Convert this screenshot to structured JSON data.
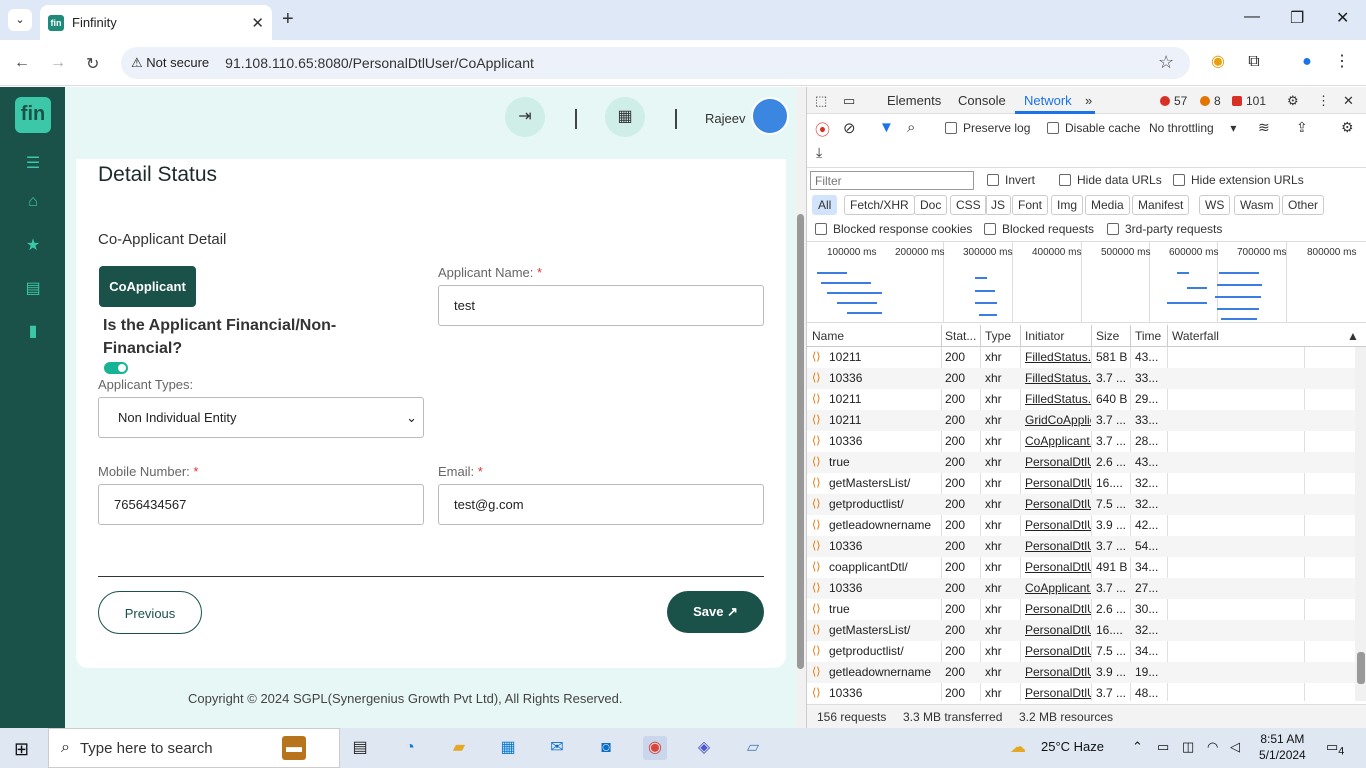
{
  "browser": {
    "tab_title": "Finfinity",
    "not_secure": "Not secure",
    "url": "91.108.110.65:8080/PersonalDtlUser/CoApplicant"
  },
  "app": {
    "logo_text": "fin",
    "user_name": "Rajeev",
    "page_title": "Detail Status",
    "section_title": "Co-Applicant Detail",
    "coapplicant_button": "CoApplicant",
    "question": "Is the Applicant Financial/Non-Financial?",
    "applicant_types_label": "Applicant Types:",
    "applicant_types_value": "Non Individual Entity",
    "applicant_name_label": "Applicant Name:",
    "applicant_name_value": "test",
    "mobile_label": "Mobile Number:",
    "mobile_value": "7656434567",
    "email_label": "Email:",
    "email_value": "test@g.com",
    "required_mark": "*",
    "previous_button": "Previous",
    "save_button": "Save ↗",
    "footer": "Copyright © 2024 SGPL(Synergenius Growth Pvt Ltd), All Rights Reserved."
  },
  "devtools": {
    "tabs": [
      "Elements",
      "Console",
      "Network"
    ],
    "errors": "57",
    "warnings": "8",
    "issues": "101",
    "preserve_log": "Preserve log",
    "disable_cache": "Disable cache",
    "throttling": "No throttling",
    "filter_placeholder": "Filter",
    "invert": "Invert",
    "hide_data_urls": "Hide data URLs",
    "hide_extension_urls": "Hide extension URLs",
    "type_filters": [
      "All",
      "Fetch/XHR",
      "Doc",
      "CSS",
      "JS",
      "Font",
      "Img",
      "Media",
      "Manifest",
      "WS",
      "Wasm",
      "Other"
    ],
    "blocked_cookies": "Blocked response cookies",
    "blocked_requests": "Blocked requests",
    "third_party": "3rd-party requests",
    "timeline_ticks": [
      "100000 ms",
      "200000 ms",
      "300000 ms",
      "400000 ms",
      "500000 ms",
      "600000 ms",
      "700000 ms",
      "800000 ms"
    ],
    "columns": [
      "Name",
      "Stat...",
      "Type",
      "Initiator",
      "Size",
      "Time",
      "Waterfall"
    ],
    "rows": [
      {
        "name": "10211",
        "status": "200",
        "type": "xhr",
        "initiator": "FilledStatus.",
        "size": "581 B",
        "time": "43..."
      },
      {
        "name": "10336",
        "status": "200",
        "type": "xhr",
        "initiator": "FilledStatus.",
        "size": "3.7 ...",
        "time": "33..."
      },
      {
        "name": "10211",
        "status": "200",
        "type": "xhr",
        "initiator": "FilledStatus.",
        "size": "640 B",
        "time": "29..."
      },
      {
        "name": "10211",
        "status": "200",
        "type": "xhr",
        "initiator": "GridCoApplic",
        "size": "3.7 ...",
        "time": "33..."
      },
      {
        "name": "10336",
        "status": "200",
        "type": "xhr",
        "initiator": "CoApplicant.",
        "size": "3.7 ...",
        "time": "28..."
      },
      {
        "name": "true",
        "status": "200",
        "type": "xhr",
        "initiator": "PersonalDtlU",
        "size": "2.6 ...",
        "time": "43..."
      },
      {
        "name": "getMastersList/",
        "status": "200",
        "type": "xhr",
        "initiator": "PersonalDtlU",
        "size": "16....",
        "time": "32..."
      },
      {
        "name": "getproductlist/",
        "status": "200",
        "type": "xhr",
        "initiator": "PersonalDtlU",
        "size": "7.5 ...",
        "time": "32..."
      },
      {
        "name": "getleadownername",
        "status": "200",
        "type": "xhr",
        "initiator": "PersonalDtlU",
        "size": "3.9 ...",
        "time": "42..."
      },
      {
        "name": "10336",
        "status": "200",
        "type": "xhr",
        "initiator": "PersonalDtlU",
        "size": "3.7 ...",
        "time": "54..."
      },
      {
        "name": "coapplicantDtl/",
        "status": "200",
        "type": "xhr",
        "initiator": "PersonalDtlU",
        "size": "491 B",
        "time": "34..."
      },
      {
        "name": "10336",
        "status": "200",
        "type": "xhr",
        "initiator": "CoApplicant.",
        "size": "3.7 ...",
        "time": "27..."
      },
      {
        "name": "true",
        "status": "200",
        "type": "xhr",
        "initiator": "PersonalDtlU",
        "size": "2.6 ...",
        "time": "30..."
      },
      {
        "name": "getMastersList/",
        "status": "200",
        "type": "xhr",
        "initiator": "PersonalDtlU",
        "size": "16....",
        "time": "32..."
      },
      {
        "name": "getproductlist/",
        "status": "200",
        "type": "xhr",
        "initiator": "PersonalDtlU",
        "size": "7.5 ...",
        "time": "34..."
      },
      {
        "name": "getleadownername",
        "status": "200",
        "type": "xhr",
        "initiator": "PersonalDtlU",
        "size": "3.9 ...",
        "time": "19..."
      },
      {
        "name": "10336",
        "status": "200",
        "type": "xhr",
        "initiator": "PersonalDtlU",
        "size": "3.7 ...",
        "time": "48..."
      }
    ],
    "requests": "156 requests",
    "transferred": "3.3 MB transferred",
    "resources": "3.2 MB resources"
  },
  "taskbar": {
    "search_placeholder": "Type here to search",
    "weather": "25°C  Haze",
    "time": "8:51 AM",
    "date": "5/1/2024",
    "notifications": "4"
  }
}
